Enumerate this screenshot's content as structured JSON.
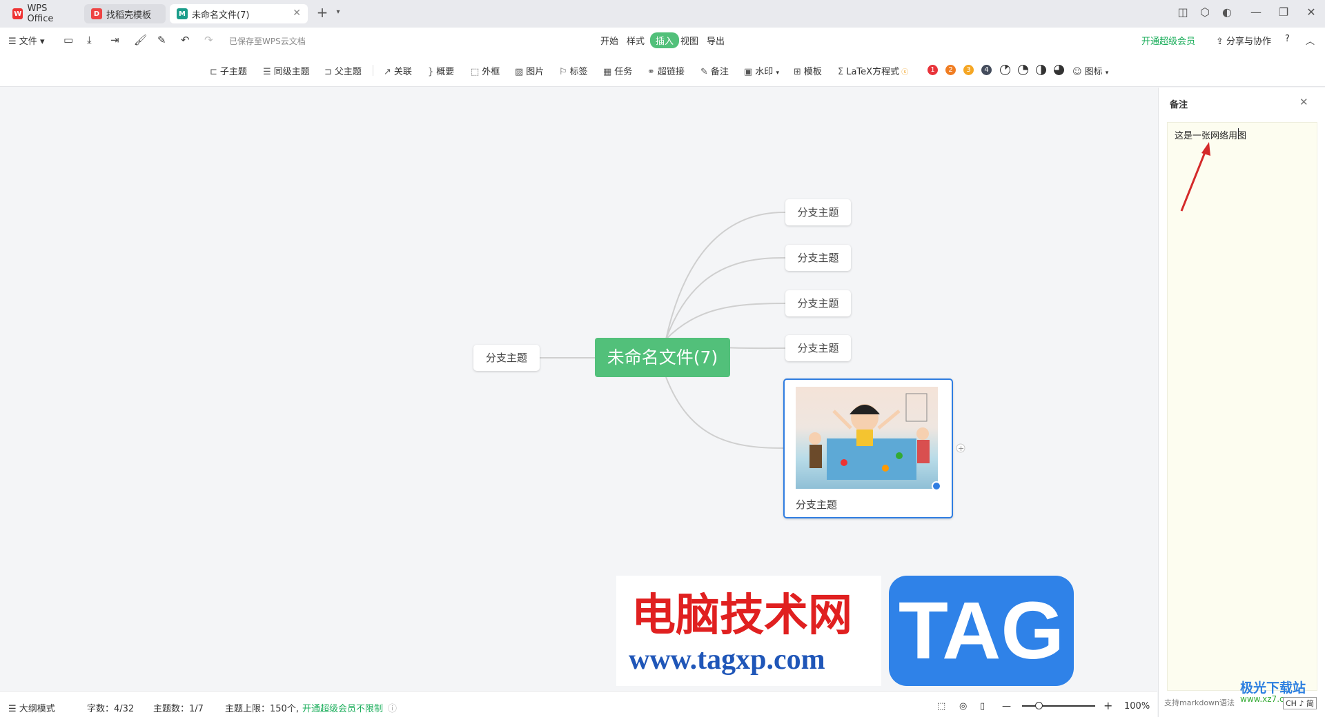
{
  "tabs": [
    {
      "label": "WPS Office"
    },
    {
      "label": "找稻壳模板"
    },
    {
      "label": "未命名文件(7)"
    }
  ],
  "menu": {
    "file_label": "文件",
    "save_status": "已保存至WPS云文档",
    "items": [
      "开始",
      "样式",
      "插入",
      "视图",
      "导出"
    ],
    "active_item": "插入",
    "vip_label": "开通超级会员",
    "share_label": "分享与协作"
  },
  "toolbar": {
    "items": [
      "子主题",
      "同级主题",
      "父主题",
      "关联",
      "概要",
      "外框",
      "图片",
      "标签",
      "任务",
      "超链接",
      "备注",
      "水印",
      "模板",
      "LaTeX方程式",
      "图标"
    ],
    "priority_labels": [
      "1",
      "2",
      "3",
      "4"
    ]
  },
  "mindmap": {
    "central": "未命名文件(7)",
    "left_branch": "分支主题",
    "right_branches": [
      "分支主题",
      "分支主题",
      "分支主题",
      "分支主题"
    ],
    "image_branch_label": "分支主题"
  },
  "notes": {
    "title": "备注",
    "content": "这是一张网络用图",
    "footer": "支持markdown语法"
  },
  "watermark": {
    "site_name": "电脑技术网",
    "site_url": "www.tagxp.com",
    "tag_text": "TAG",
    "corner_text": "极光下载站",
    "corner_url": "www.xz7.com",
    "ime": "CH ♪ 简"
  },
  "status": {
    "outline_mode": "大纲模式",
    "word_count": "字数：4/32",
    "topic_count": "主题数：1/7",
    "topic_limit": "主题上限：150个,",
    "vip_unlimited": "开通超级会员不限制",
    "zoom": "100%"
  },
  "colors": {
    "central": "#52c07a",
    "selected_border": "#2f7de1",
    "vip_green": "#1aad5a"
  }
}
